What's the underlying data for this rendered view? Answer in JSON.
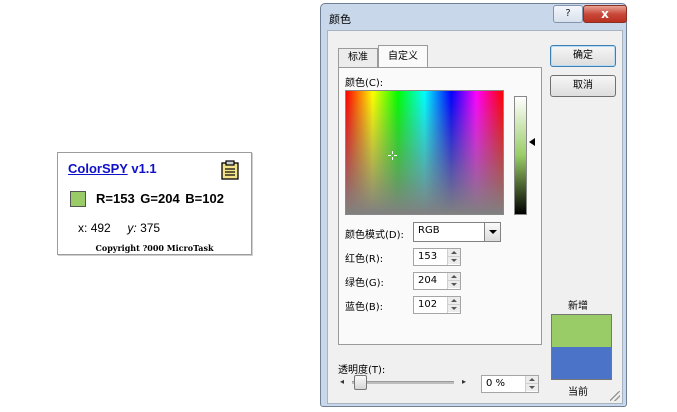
{
  "colorspy": {
    "app_name": "ColorSPY",
    "version": "v1.1",
    "rgb_text": "R=153  G=204  B=102",
    "x_label": "x:",
    "x_value": "492",
    "y_label": "y:",
    "y_value": "375",
    "copyright": "Copyright ?000 MicroTask",
    "swatch_color": "#99cc66",
    "clipboard_icon": "clipboard-icon"
  },
  "dialog": {
    "title": "颜色",
    "help_label": "?",
    "close_label": "x",
    "tabs": [
      {
        "label": "标准",
        "active": false
      },
      {
        "label": "自定义",
        "active": true
      }
    ],
    "colors_label": "颜色(C):",
    "color_mode_label": "颜色模式(D):",
    "color_mode_value": "RGB",
    "red_label": "红色(R):",
    "red_value": "153",
    "green_label": "绿色(G):",
    "green_value": "204",
    "blue_label": "蓝色(B):",
    "blue_value": "102",
    "ok_label": "确定",
    "cancel_label": "取消",
    "new_label": "新增",
    "current_label": "当前",
    "new_color": "#99cc66",
    "current_color": "#4b74c9",
    "transparency_label": "透明度(T):",
    "transparency_value": "0 %",
    "transparency_fraction": 0
  }
}
